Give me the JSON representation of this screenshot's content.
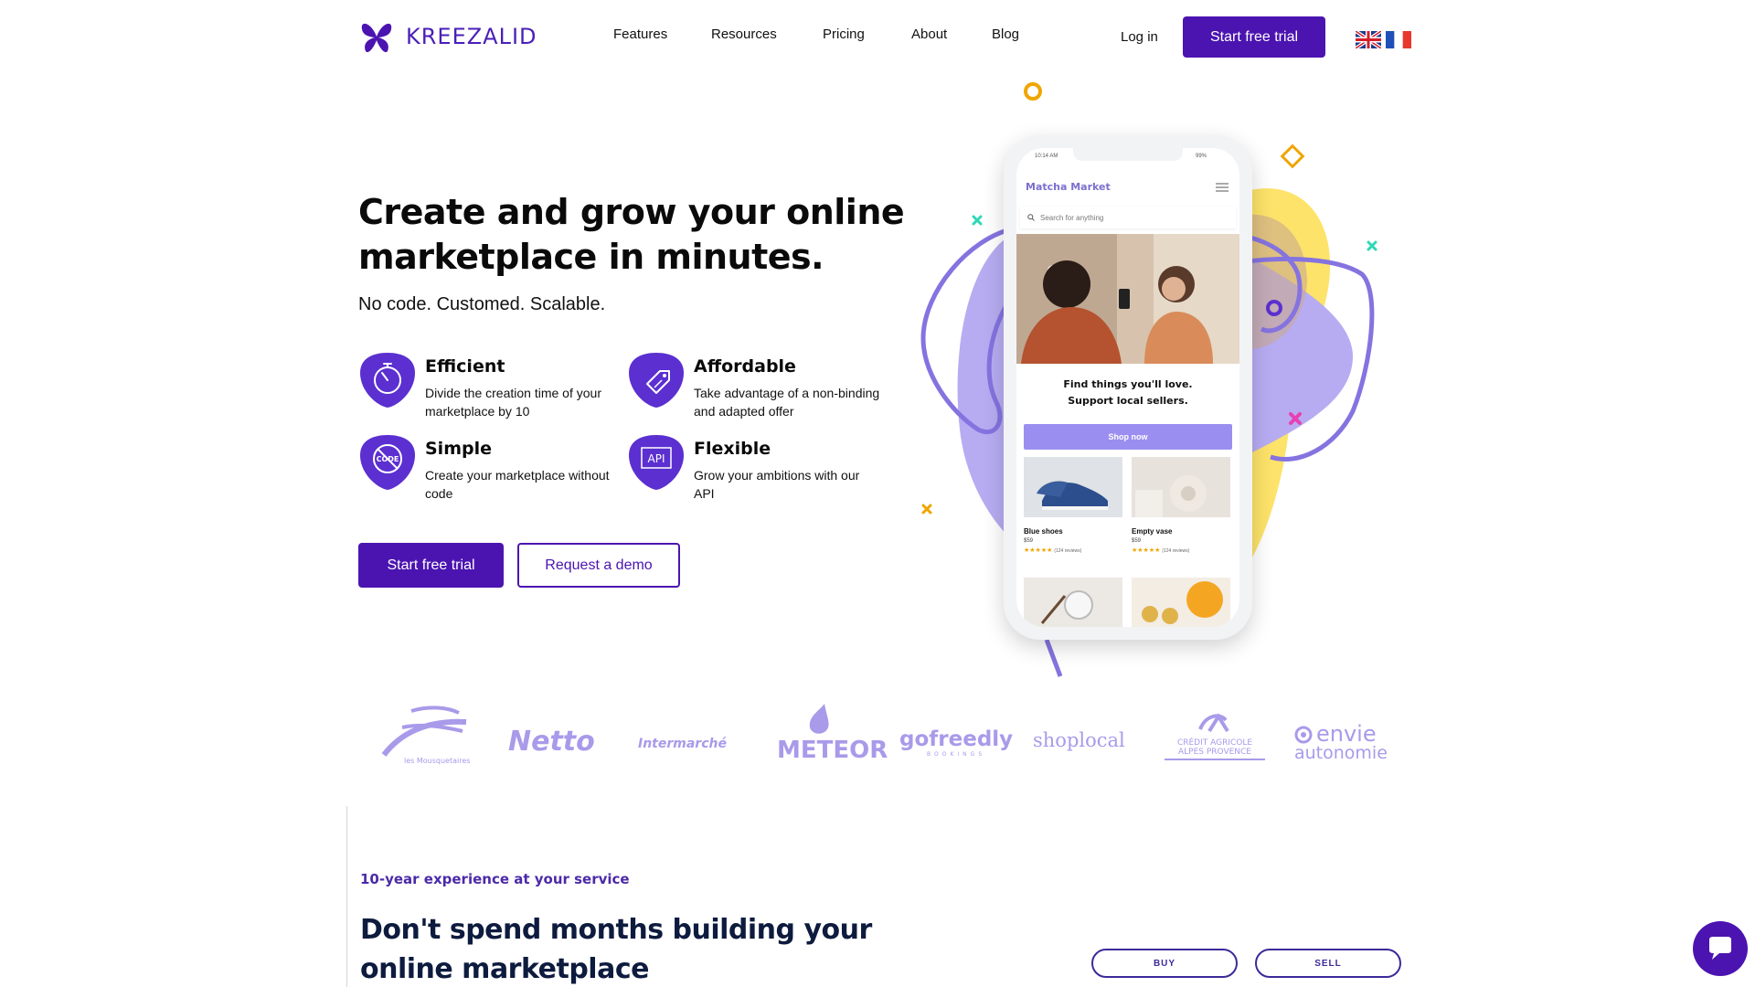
{
  "header": {
    "brand": "KREEZALID",
    "nav": [
      "Features",
      "Resources",
      "Pricing",
      "About",
      "Blog"
    ],
    "login": "Log in",
    "cta": "Start free trial"
  },
  "hero": {
    "title": "Create and grow your online marketplace in minutes.",
    "subtitle": "No code. Customed. Scalable.",
    "features": [
      {
        "title": "Efficient",
        "text": "Divide the creation time of your marketplace by 10"
      },
      {
        "title": "Affordable",
        "text": "Take advantage of a non-binding and adapted offer"
      },
      {
        "title": "Simple",
        "text": "Create your marketplace without code"
      },
      {
        "title": "Flexible",
        "text": "Grow your ambitions with our API"
      }
    ],
    "primary_cta": "Start free trial",
    "secondary_cta": "Request a demo"
  },
  "phone": {
    "time": "10:14 AM",
    "battery": "99%",
    "app_title": "Matcha Market",
    "search_placeholder": "Search for anything",
    "promo_line1": "Find things you'll love.",
    "promo_line2": "Support local sellers.",
    "shop_button": "Shop now",
    "products": [
      {
        "name": "Blue shoes",
        "price": "$59",
        "reviews": "(124 reviews)"
      },
      {
        "name": "Empty vase",
        "price": "$59",
        "reviews": "(124 reviews)"
      }
    ]
  },
  "logos": {
    "mousquetaires": "les Mousquetaires",
    "netto": "Netto",
    "intermarche": "Intermarché",
    "meteor": "METEOR",
    "gofreedly": "gofreedly",
    "gofreedly_sub": "BOOKINGS",
    "shoplocal": "shoplocal",
    "credit_agricole_line1": "CRÉDIT AGRICOLE",
    "credit_agricole_line2": "ALPES PROVENCE",
    "envie_line1": "envie",
    "envie_line2": "autonomie"
  },
  "section": {
    "eyebrow": "10-year experience at your service",
    "title": "Don't spend months building your online marketplace",
    "pill_buy": "BUY",
    "pill_sell": "SELL"
  },
  "colors": {
    "brand": "#4b14b0",
    "lavender": "#a99aea",
    "yellow": "#fde36a"
  }
}
